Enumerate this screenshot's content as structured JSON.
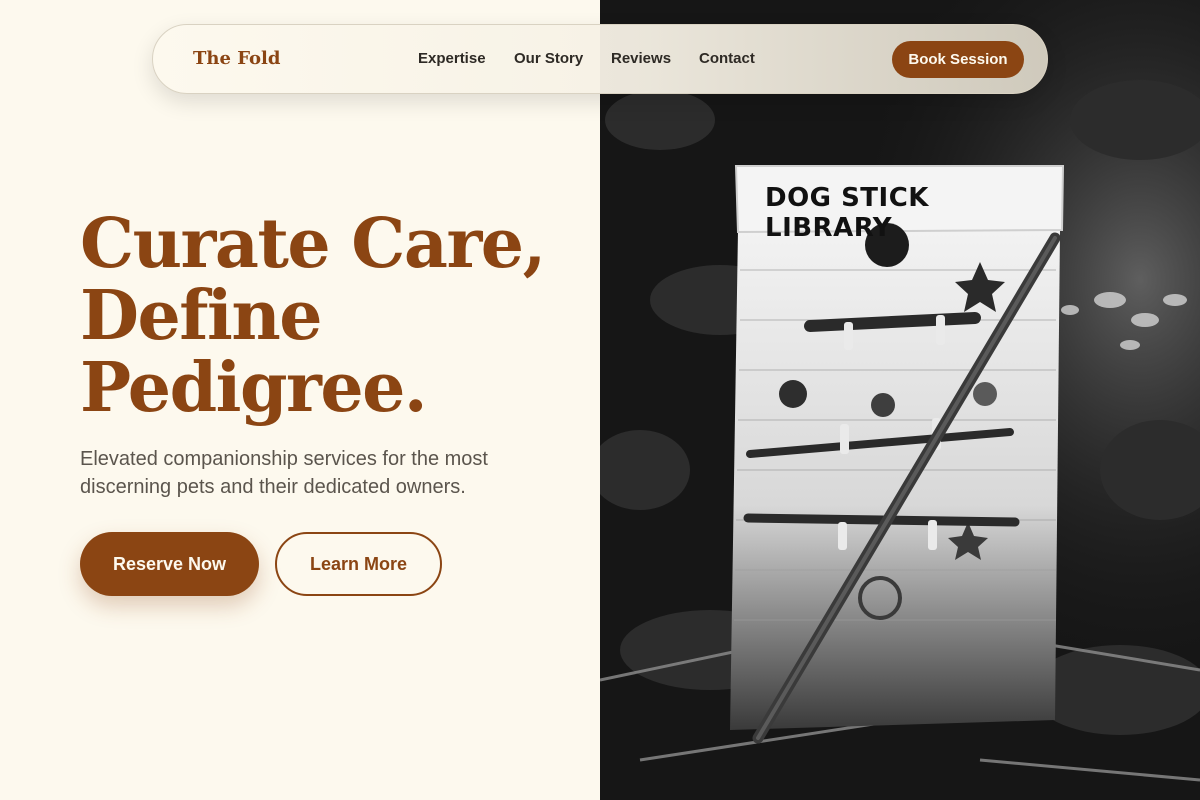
{
  "brand": {
    "name": "The Fold"
  },
  "nav": {
    "links": [
      "Expertise",
      "Our Story",
      "Reviews",
      "Contact"
    ],
    "cta": "Book Session"
  },
  "hero": {
    "title_lines": [
      "Curate Care,",
      "Define",
      "Pedigree."
    ],
    "subtitle": "Elevated companionship services for the most discerning pets and their dedicated owners.",
    "primary_cta": "Reserve Now",
    "secondary_cta": "Learn More"
  },
  "photo": {
    "sign_text": "DOG STICK LIBRARY"
  },
  "colors": {
    "accent": "#8b4513",
    "background": "#fdf9ee",
    "text": "#2e2a25",
    "muted_text": "#5b554d"
  }
}
